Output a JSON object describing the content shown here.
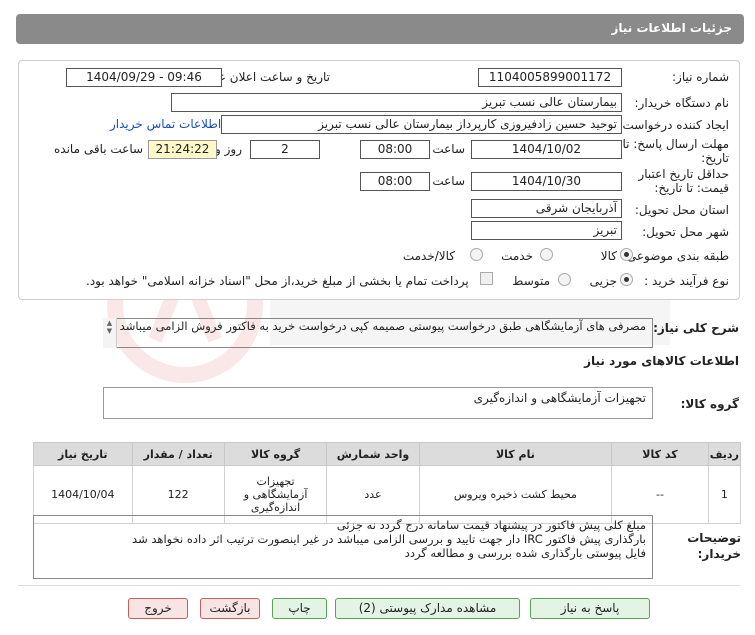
{
  "header": {
    "title": "جزئیات اطلاعات نیاز"
  },
  "form": {
    "need_number_label": "شماره نیاز:",
    "need_number": "1104005899001172",
    "announce_label": "تاریخ و ساعت اعلان عمومی:",
    "announce_value": "1404/09/29 - 09:46",
    "buyer_org_label": "نام دستگاه خریدار:",
    "buyer_org": "بیمارستان عالی نسب تبریز",
    "creator_label": "ایجاد کننده درخواست:",
    "creator": "توحید حسین زادفیروزی کارپرداز بیمارستان عالی نسب تبریز",
    "contact_link": "اطلاعات تماس خریدار",
    "deadline_label_1": "مهلت ارسال پاسخ: تا",
    "deadline_label_2": "تاریخ:",
    "deadline_date": "1404/10/02",
    "time_label": "ساعت",
    "deadline_time": "08:00",
    "days_value": "2",
    "days_label": "روز و",
    "remaining_time": "21:24:22",
    "remaining_label": "ساعت باقی مانده",
    "validity_label_1": "حداقل تاریخ اعتبار",
    "validity_label_2": "قیمت: تا تاریخ:",
    "validity_date": "1404/10/30",
    "validity_time": "08:00",
    "province_label": "استان محل تحویل:",
    "province": "آذربایجان شرقی",
    "city_label": "شهر محل تحویل:",
    "city": "تبریز",
    "category_label": "طبقه بندی موضوعی:",
    "category_options": [
      "کالا",
      "خدمت",
      "کالا/خدمت"
    ],
    "category_selected": "کالا",
    "process_label": "نوع فرآیند خرید :",
    "process_options": [
      "جزیی",
      "متوسط"
    ],
    "process_selected": "جزیی",
    "payment_note": "پرداخت تمام یا بخشی از مبلغ خرید،از محل \"اسناد خزانه اسلامی\" خواهد بود."
  },
  "description": {
    "label": "شرح کلی نیاز:",
    "text": "مصرفی های آزمایشگاهی طبق درخواست پیوستی صمیمه کپی درخواست خرید به فاکتور فروش الزامی میباشد"
  },
  "goods": {
    "section_title": "اطلاعات کالاهای مورد نیاز",
    "group_label": "گروه کالا:",
    "group_value": "تجهیزات آزمایشگاهی و اندازه‌گیری",
    "columns": [
      "ردیف",
      "کد کالا",
      "نام کالا",
      "واحد شمارش",
      "گروه کالا",
      "تعداد / مقدار",
      "تاریخ نیاز"
    ],
    "rows": [
      {
        "row": "1",
        "code": "--",
        "name": "محیط کشت ذخیره ویروس",
        "unit": "عدد",
        "group": "تجهیزات آزمایشگاهی و اندازه‌گیری",
        "qty": "122",
        "date": "1404/10/04"
      }
    ]
  },
  "buyer_notes": {
    "label_1": "توضیحات",
    "label_2": "خریدار:",
    "lines": [
      "مبلغ کلی پیش فاکتور در پیشنهاد قیمت سامانه درج گردد نه جزئی",
      "بارگذاری پیش فاکتور IRC دار جهت تایید و بررسی الزامی میباشد در غیر اینصورت ترتیب اثر داده نخواهد شد",
      "فایل پیوستی بارگذاری شده بررسی و مطالعه گردد"
    ]
  },
  "buttons": {
    "reply": "پاسخ به نیاز",
    "attachments": "مشاهده مدارک پیوستی (2)",
    "print": "چاپ",
    "back": "بازگشت",
    "exit": "خروج"
  },
  "colors": {
    "title_bar": "#8a8a8a",
    "link": "#1a4fb5",
    "remaining_bg": "#fff8c8",
    "button_bg": "#e4f4e4",
    "button_red_bg": "#f9e4e4"
  }
}
